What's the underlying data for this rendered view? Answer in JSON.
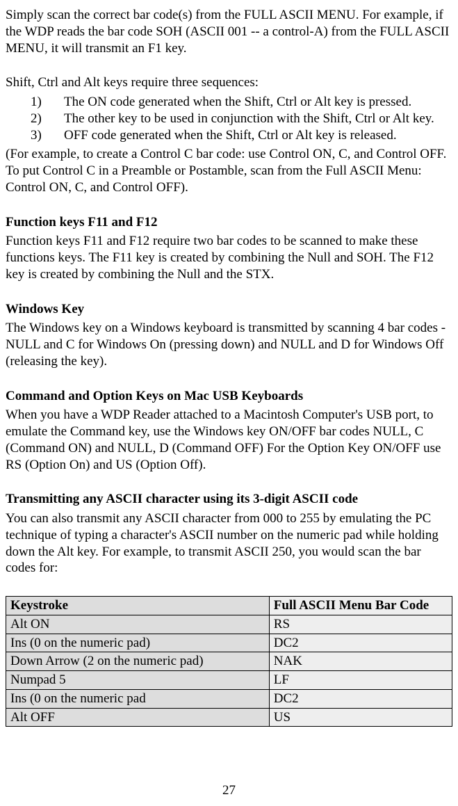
{
  "p1": " Simply scan the correct bar code(s) from the FULL ASCII MENU. For example, if the WDP reads the bar code SOH (ASCII 001 -- a control-A) from the FULL ASCII MENU, it will transmit an F1 key.",
  "p2": "Shift, Ctrl and Alt keys require three sequences:",
  "list": [
    {
      "num": "1)",
      "text": "The ON code generated when the Shift, Ctrl or Alt key is pressed."
    },
    {
      "num": "2)",
      "text": "The other key to be used in conjunction with the Shift, Ctrl or Alt key."
    },
    {
      "num": "3)",
      "text": "OFF code generated when the Shift, Ctrl or Alt key is released."
    }
  ],
  "p3": "(For example, to create a Control C bar code: use Control ON, C, and Control OFF.  To put Control C in a Preamble or Postamble, scan from the Full ASCII Menu: Control ON, C, and Control OFF).",
  "h1": "Function keys F11 and F12",
  "p4": "Function keys F11 and F12 require two bar codes to be scanned to make these functions keys.  The F11 key is created by combining the Null and SOH.  The F12 key is created by combining the Null and the STX.",
  "h2": "Windows Key",
  "p5": "The Windows key on a Windows keyboard is transmitted by scanning 4 bar codes - NULL and C for Windows On (pressing down) and NULL and D for Windows Off (releasing the key).",
  "h3": "Command and Option Keys on Mac USB Keyboards",
  "p6": "When you have a WDP Reader attached to a Macintosh Computer's USB port, to emulate the Command key, use the Windows key ON/OFF bar codes NULL, C (Command ON) and NULL, D (Command OFF) For the Option Key ON/OFF use RS (Option On) and US (Option Off).",
  "h4": "Transmitting any ASCII character using its 3-digit ASCII code",
  "p7": "You can also transmit any ASCII character from 000 to 255 by emulating the PC technique of typing a character's ASCII number on the numeric pad while holding down the Alt key. For example, to transmit ASCII 250, you would scan the bar codes for:",
  "table": {
    "header_left": "Keystroke",
    "header_right": "Full ASCII Menu Bar Code",
    "rows": [
      {
        "left": "Alt ON",
        "right": "RS"
      },
      {
        "left": "Ins (0 on the numeric pad)",
        "right": "DC2"
      },
      {
        "left": "Down Arrow (2 on the numeric pad)",
        "right": "NAK"
      },
      {
        "left": "Numpad 5",
        "right": "LF"
      },
      {
        "left": "Ins (0 on the numeric pad",
        "right": "DC2"
      },
      {
        "left": "Alt OFF",
        "right": "US"
      }
    ]
  },
  "page_number": "27"
}
